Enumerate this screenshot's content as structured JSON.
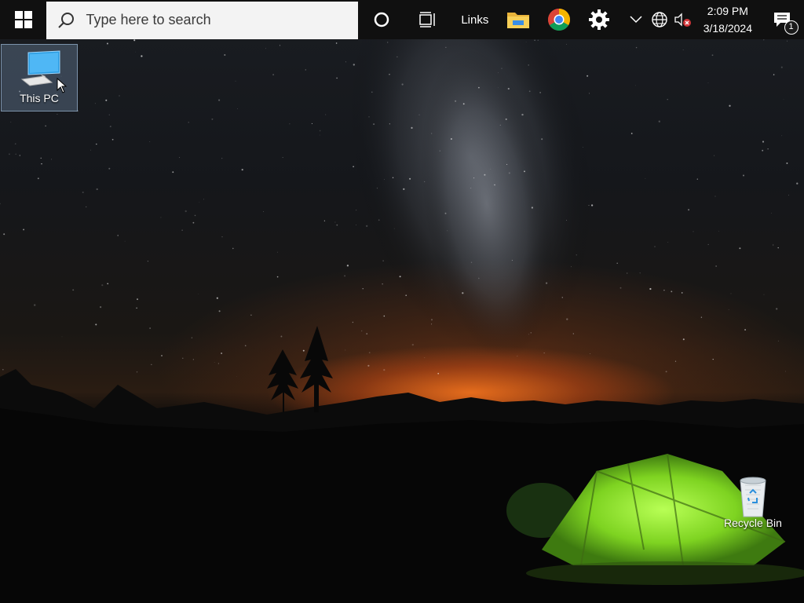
{
  "taskbar": {
    "start_icon": "windows-logo-icon",
    "search": {
      "placeholder": "Type here to search",
      "icon": "search-icon"
    },
    "cortana_icon": "cortana-circle-icon",
    "taskview_icon": "task-view-icon",
    "links_label": "Links",
    "pinned_apps": [
      {
        "name": "File Explorer",
        "icon": "folder-icon"
      },
      {
        "name": "Google Chrome",
        "icon": "chrome-icon"
      },
      {
        "name": "Settings",
        "icon": "gear-icon"
      }
    ],
    "tray": {
      "overflow_icon": "chevron-up-icon",
      "network_icon": "globe-icon",
      "volume_icon": "volume-muted-icon"
    },
    "clock": {
      "time": "2:09 PM",
      "date": "3/18/2024"
    },
    "notifications": {
      "icon": "action-center-icon",
      "count": "1"
    }
  },
  "desktop": {
    "icons": [
      {
        "label": "This PC",
        "icon": "computer-icon",
        "selected": true
      },
      {
        "label": "Recycle Bin",
        "icon": "recycle-bin-icon",
        "selected": false
      }
    ]
  },
  "colors": {
    "taskbar_bg": "#101010",
    "search_bg": "#f3f3f3",
    "tent_green": "#8ee82a",
    "horizon_orange": "#ff7a1e"
  }
}
